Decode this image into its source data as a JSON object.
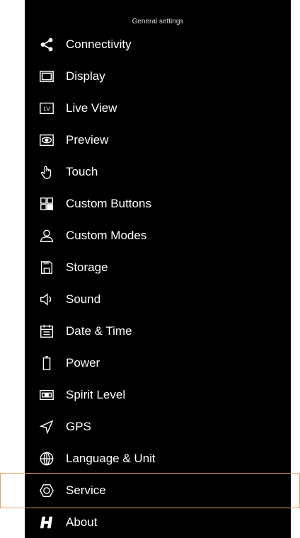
{
  "header": {
    "title": "General settings"
  },
  "colors": {
    "background": "#000000",
    "text": "#ffffff",
    "highlight": "#f0a15e"
  },
  "menu": {
    "items": [
      {
        "label": "Connectivity",
        "icon": "share-icon"
      },
      {
        "label": "Display",
        "icon": "display-icon"
      },
      {
        "label": "Live View",
        "icon": "live-view-icon"
      },
      {
        "label": "Preview",
        "icon": "preview-eye-icon"
      },
      {
        "label": "Touch",
        "icon": "touch-hand-icon"
      },
      {
        "label": "Custom Buttons",
        "icon": "custom-buttons-grid-icon"
      },
      {
        "label": "Custom Modes",
        "icon": "user-icon"
      },
      {
        "label": "Storage",
        "icon": "storage-card-icon"
      },
      {
        "label": "Sound",
        "icon": "speaker-icon"
      },
      {
        "label": "Date & Time",
        "icon": "calendar-icon"
      },
      {
        "label": "Power",
        "icon": "battery-icon"
      },
      {
        "label": "Spirit Level",
        "icon": "spirit-level-icon"
      },
      {
        "label": "GPS",
        "icon": "gps-arrow-icon"
      },
      {
        "label": "Language & Unit",
        "icon": "globe-icon"
      },
      {
        "label": "Service",
        "icon": "hexagon-icon",
        "selected": true
      },
      {
        "label": "About",
        "icon": "hasselblad-h-icon"
      }
    ]
  }
}
